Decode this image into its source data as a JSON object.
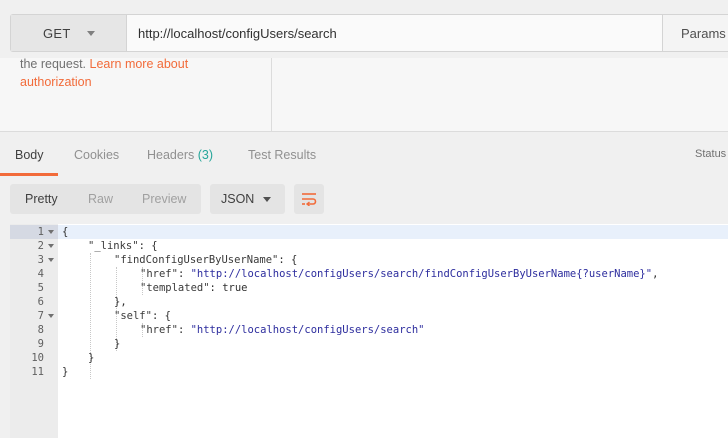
{
  "request": {
    "method": "GET",
    "url": "http://localhost/configUsers/search",
    "params_label": "Params"
  },
  "auth": {
    "text_prefix": "the request.",
    "link_text_1": "Learn more about",
    "link_text_2": "authorization"
  },
  "tabs": [
    {
      "label": "Body",
      "active": true
    },
    {
      "label": "Cookies"
    },
    {
      "label": "Headers",
      "count": "(3)"
    },
    {
      "label": "Test Results"
    }
  ],
  "status_label": "Status",
  "response_toolbar": {
    "views": [
      "Pretty",
      "Raw",
      "Preview"
    ],
    "format": "JSON",
    "wrap_icon": "wrap-lines-icon"
  },
  "accent_color": "#f26b3a",
  "line_numbers": [
    "1",
    "2",
    "3",
    "4",
    "5",
    "6",
    "7",
    "8",
    "9",
    "10",
    "11"
  ],
  "code": {
    "l1": "{",
    "l2_key": "\"_links\"",
    "l2_rest": ": {",
    "l3_key": "\"findConfigUserByUserName\"",
    "l3_rest": ": {",
    "l4_key": "\"href\"",
    "l4_sep": ": ",
    "l4_val": "\"http://localhost/configUsers/search/findConfigUserByUserName{?userName}\"",
    "l4_end": ",",
    "l5_key": "\"templated\"",
    "l5_rest": ": true",
    "l6": "},",
    "l7_key": "\"self\"",
    "l7_rest": ": {",
    "l8_key": "\"href\"",
    "l8_sep": ": ",
    "l8_val": "\"http://localhost/configUsers/search\"",
    "l9": "}",
    "l10": "}",
    "l11": "}"
  }
}
